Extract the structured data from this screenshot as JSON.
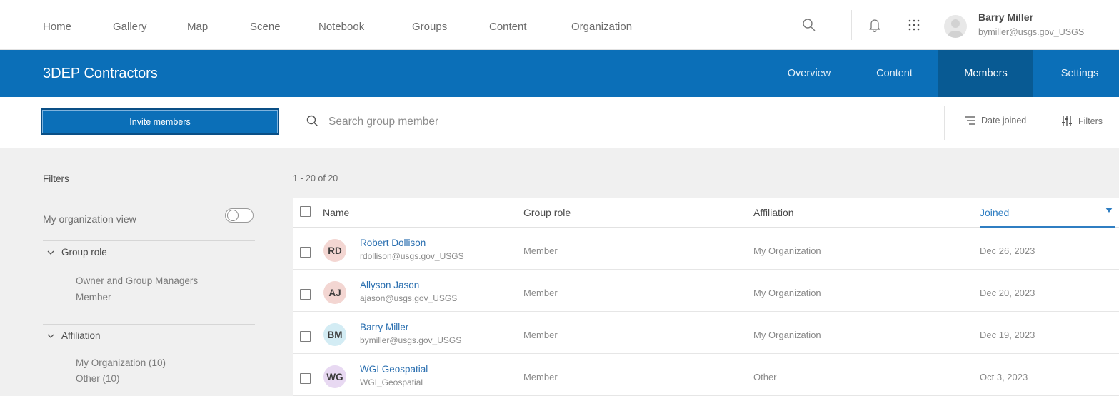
{
  "topnav": {
    "links": [
      "Home",
      "Gallery",
      "Map",
      "Scene",
      "Notebook",
      "Groups",
      "Content",
      "Organization"
    ],
    "user": {
      "name": "Barry Miller",
      "email": "bymiller@usgs.gov_USGS"
    }
  },
  "group": {
    "title": "3DEP Contractors",
    "tabs": [
      "Overview",
      "Content",
      "Members",
      "Settings"
    ],
    "active_tab": "Members"
  },
  "toolbar": {
    "invite_label": "Invite members",
    "search_placeholder": "Search group member",
    "sort_label": "Date joined",
    "filters_label": "Filters"
  },
  "sidebar": {
    "title": "Filters",
    "org_view_label": "My organization view",
    "org_view_on": false,
    "group_role": {
      "label": "Group role",
      "options": [
        "Owner and Group Managers",
        "Member"
      ]
    },
    "affiliation": {
      "label": "Affiliation",
      "options": [
        "My Organization (10)",
        "Other (10)"
      ]
    }
  },
  "results": {
    "count": "1 - 20 of 20",
    "columns": {
      "name": "Name",
      "role": "Group role",
      "affiliation": "Affiliation",
      "joined": "Joined"
    },
    "rows": [
      {
        "initials": "RD",
        "avatar_color": "#f3d6d2",
        "name": "Robert Dollison",
        "email": "rdollison@usgs.gov_USGS",
        "role": "Member",
        "affiliation": "My Organization",
        "joined": "Dec 26, 2023"
      },
      {
        "initials": "AJ",
        "avatar_color": "#f3d6d2",
        "name": "Allyson Jason",
        "email": "ajason@usgs.gov_USGS",
        "role": "Member",
        "affiliation": "My Organization",
        "joined": "Dec 20, 2023"
      },
      {
        "initials": "BM",
        "avatar_color": "#d3ecf4",
        "name": "Barry Miller",
        "email": "bymiller@usgs.gov_USGS",
        "role": "Member",
        "affiliation": "My Organization",
        "joined": "Dec 19, 2023"
      },
      {
        "initials": "WG",
        "avatar_color": "#e8d9f2",
        "name": "WGI Geospatial",
        "email": "WGI_Geospatial",
        "role": "Member",
        "affiliation": "Other",
        "joined": "Oct 3, 2023"
      }
    ]
  }
}
